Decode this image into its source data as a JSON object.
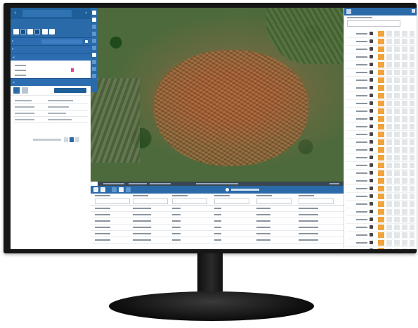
{
  "monitor": {
    "bezel_color": "#161616"
  },
  "colors": {
    "primary": "#2a6aa8",
    "primary_dark": "#1f5f99",
    "accent_orange": "#f0a43a",
    "accent_pink": "#e040a0"
  },
  "left_panel": {
    "title": "",
    "sections": [
      {
        "label": "",
        "value": ""
      },
      {
        "label": ""
      },
      {
        "label": ""
      }
    ],
    "form_fields": [
      {
        "label": ""
      },
      {
        "label": ""
      },
      {
        "label": ""
      }
    ],
    "records": [
      [
        "",
        ""
      ],
      [
        "",
        ""
      ],
      [
        "",
        ""
      ]
    ],
    "pager_text": ""
  },
  "map": {
    "imagery": "aerial photo of a hillside town with terracotta roofs",
    "status_text": ""
  },
  "bottom_panel": {
    "title": "",
    "column_count": 6,
    "row_count": 6
  },
  "right_panel": {
    "title": "",
    "row_count": 30,
    "row_icons": [
      "home-icon",
      "layers-icon",
      "pin-icon",
      "camera-icon",
      "tree-icon",
      "building-icon"
    ]
  }
}
